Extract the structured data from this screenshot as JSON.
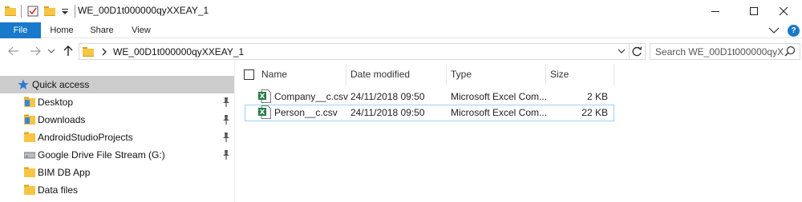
{
  "window": {
    "title": "WE_00D1t000000qyXXEAY_1",
    "controls": [
      "minimize",
      "maximize",
      "close"
    ]
  },
  "ribbon": {
    "tabs": [
      {
        "label": "File"
      },
      {
        "label": "Home"
      },
      {
        "label": "Share"
      },
      {
        "label": "View"
      }
    ]
  },
  "address": {
    "path": "WE_00D1t000000qyXXEAY_1",
    "search_placeholder": "Search WE_00D1t000000qyXX..."
  },
  "nav": {
    "items": [
      {
        "label": "Quick access",
        "icon": "star-icon",
        "pinned": false,
        "selected": true
      },
      {
        "label": "Desktop",
        "icon": "desktop-folder-icon",
        "pinned": true
      },
      {
        "label": "Downloads",
        "icon": "downloads-folder-icon",
        "pinned": true
      },
      {
        "label": "AndroidStudioProjects",
        "icon": "folder-icon",
        "pinned": true
      },
      {
        "label": "Google Drive File Stream (G:)",
        "icon": "drive-icon",
        "pinned": true
      },
      {
        "label": "BIM DB App",
        "icon": "folder-icon",
        "pinned": false
      },
      {
        "label": "Data files",
        "icon": "folder-icon",
        "pinned": false
      }
    ]
  },
  "files": {
    "columns": [
      "Name",
      "Date modified",
      "Type",
      "Size"
    ],
    "rows": [
      {
        "name": "Company__c.csv",
        "date": "24/11/2018 09:50",
        "type": "Microsoft Excel Com...",
        "size": "2 KB"
      },
      {
        "name": "Person__c.csv",
        "date": "24/11/2018 09:50",
        "type": "Microsoft Excel Com...",
        "size": "22 KB"
      }
    ]
  },
  "colors": {
    "accent": "#1979ca",
    "selected_bg": "#cccccc",
    "focus_border": "#99d1ff",
    "folder": "#f6c544"
  }
}
